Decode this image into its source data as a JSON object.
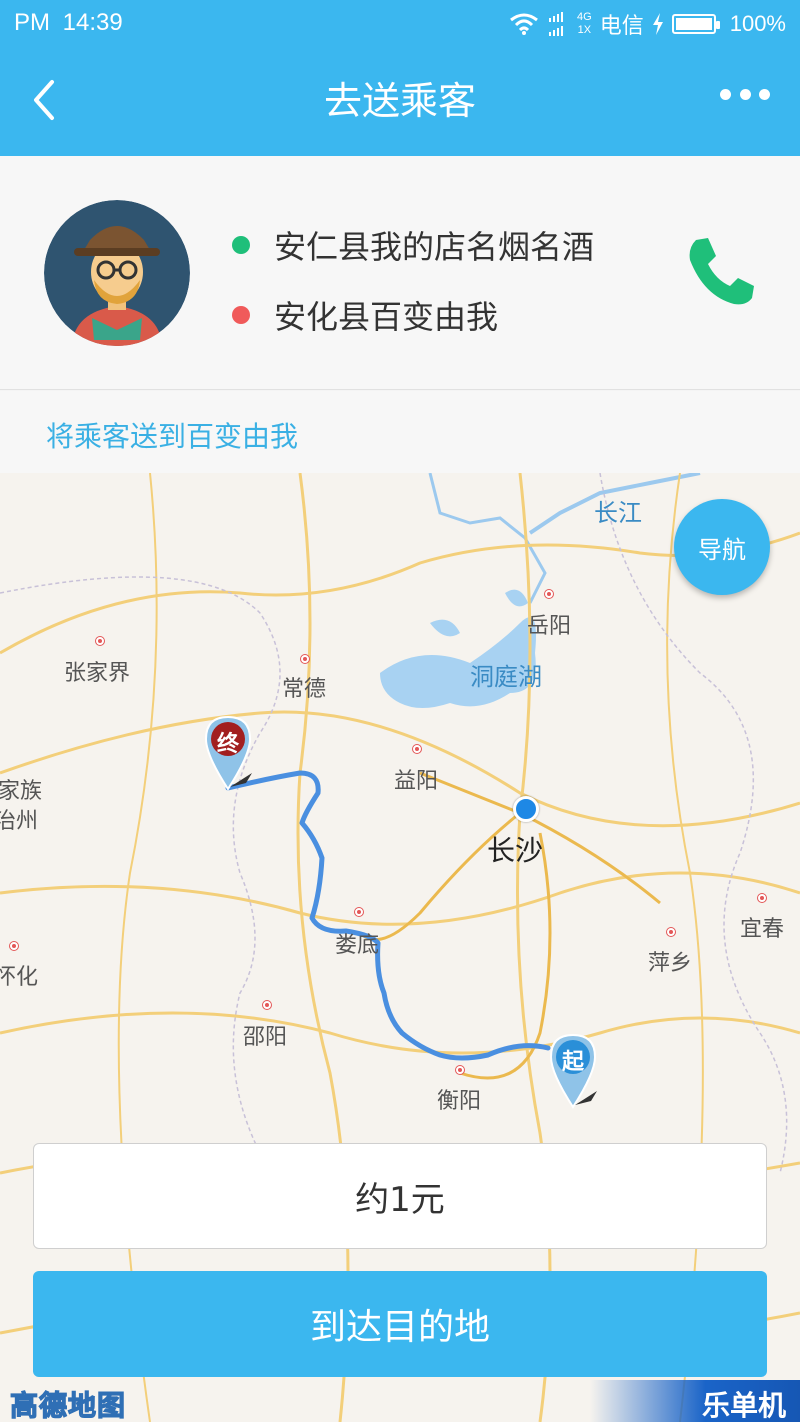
{
  "status_bar": {
    "period": "PM",
    "time": "14:39",
    "net_top": "4G",
    "net_bottom": "1X",
    "carrier": "电信",
    "battery": "100%"
  },
  "header": {
    "title": "去送乘客",
    "back_icon": "chevron-left-icon",
    "more_icon": "more-horizontal-icon"
  },
  "passenger": {
    "from": "安仁县我的店名烟名酒",
    "to": "安化县百变由我",
    "from_color": "#1fbf7a",
    "to_color": "#f05a5a",
    "phone_icon": "phone-icon",
    "phone_color": "#1fbf7a"
  },
  "hint": "将乘客送到百变由我",
  "map": {
    "nav_label": "导航",
    "cities": {
      "zhangjiajie": "张家界",
      "changde": "常德",
      "yiyang": "益阳",
      "yueyang": "岳阳",
      "changsha": "长沙",
      "loudi": "娄底",
      "shaoyang": "邵阳",
      "hengyang": "衡阳",
      "pingxiang": "萍乡",
      "yichun": "宜春",
      "huaihua": "怀化",
      "xiangxi_a": "家族",
      "xiangxi_b": "治州"
    },
    "water": {
      "dongting": "洞庭湖",
      "changjiang": "长江"
    },
    "end_pin": "终",
    "start_pin": "起",
    "route_color": "#4a8fe0"
  },
  "fare": "约1元",
  "arrive_button": "到达目的地",
  "logo": "高德地图",
  "watermark": "乐单机"
}
